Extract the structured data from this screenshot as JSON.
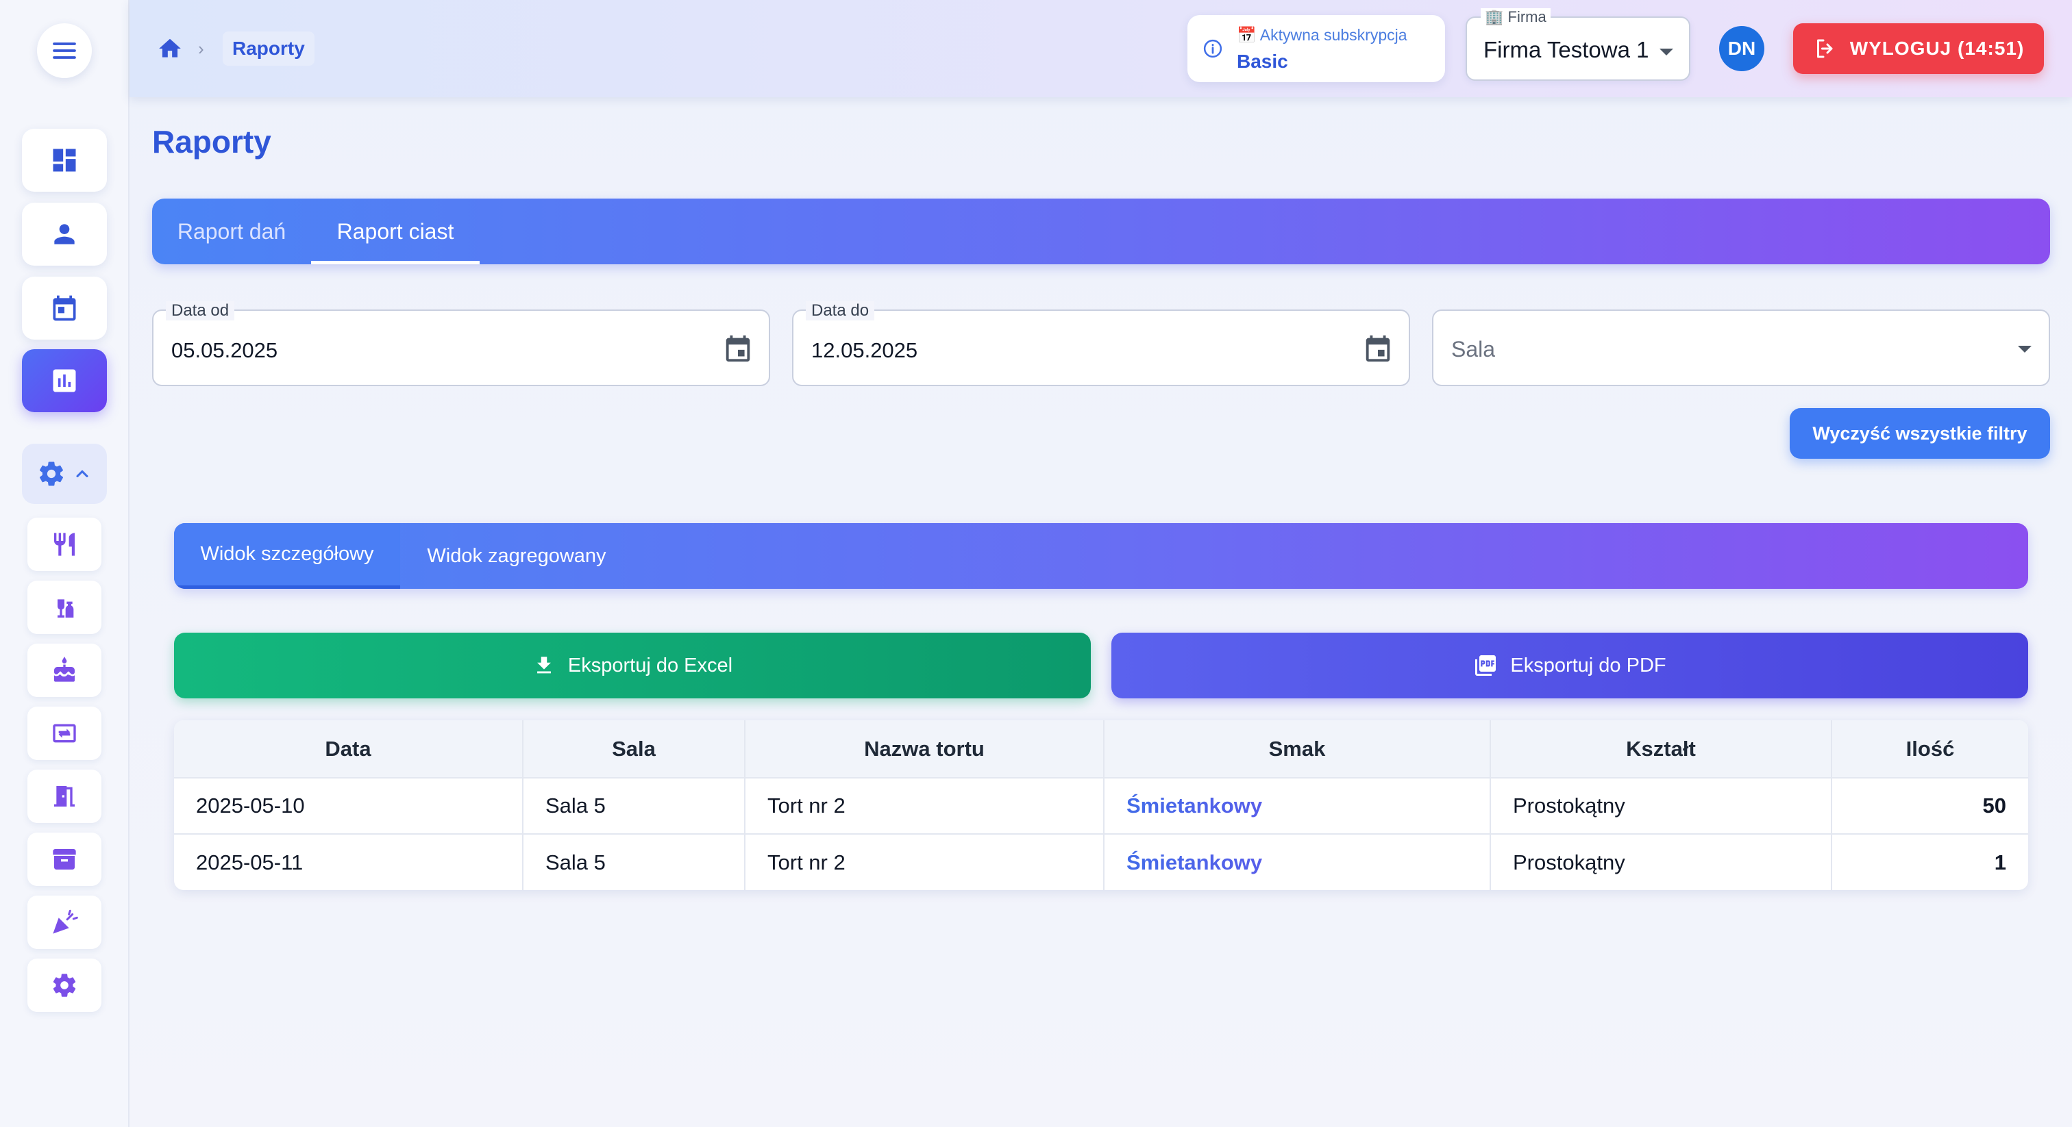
{
  "breadcrumb": {
    "current": "Raporty"
  },
  "subscription": {
    "label": "📅 Aktywna subskrypcja",
    "plan": "Basic"
  },
  "company": {
    "legend": "🏢 Firma",
    "value": "Firma Testowa 1"
  },
  "user": {
    "initials": "DN"
  },
  "logout": {
    "label": "WYLOGUJ (14:51)"
  },
  "page": {
    "title": "Raporty"
  },
  "report_tabs": [
    {
      "label": "Raport dań",
      "active": false
    },
    {
      "label": "Raport ciast",
      "active": true
    }
  ],
  "filters": {
    "date_from": {
      "label": "Data od",
      "value": "05.05.2025"
    },
    "date_to": {
      "label": "Data do",
      "value": "12.05.2025"
    },
    "room": {
      "placeholder": "Sala"
    },
    "clear_label": "Wyczyść wszystkie filtry"
  },
  "view_tabs": [
    {
      "label": "Widok szczegółowy",
      "active": true
    },
    {
      "label": "Widok zagregowany",
      "active": false
    }
  ],
  "export": {
    "excel_label": "Eksportuj do Excel",
    "pdf_label": "Eksportuj do PDF"
  },
  "table": {
    "headers": [
      "Data",
      "Sala",
      "Nazwa tortu",
      "Smak",
      "Kształt",
      "Ilość"
    ],
    "rows": [
      [
        "2025-05-10",
        "Sala 5",
        "Tort nr 2",
        "Śmietankowy",
        "Prostokątny",
        "50"
      ],
      [
        "2025-05-11",
        "Sala 5",
        "Tort nr 2",
        "Śmietankowy",
        "Prostokątny",
        "1"
      ]
    ]
  },
  "sidebar": {
    "icons": [
      "menu-icon",
      "dashboard-icon",
      "person-icon",
      "calendar-icon",
      "bar-chart-icon",
      "gear-icon",
      "chevron-up-icon",
      "restaurant-icon",
      "drinks-icon",
      "cake-icon",
      "transfer-icon",
      "door-icon",
      "archive-icon",
      "party-icon",
      "gear-icon"
    ]
  },
  "colors": {
    "primary": "#2f56d8",
    "accent_gradient_start": "#4b84f5",
    "accent_gradient_end": "#8b50f0",
    "danger": "#ef3e48",
    "success": "#0c9a6c"
  }
}
